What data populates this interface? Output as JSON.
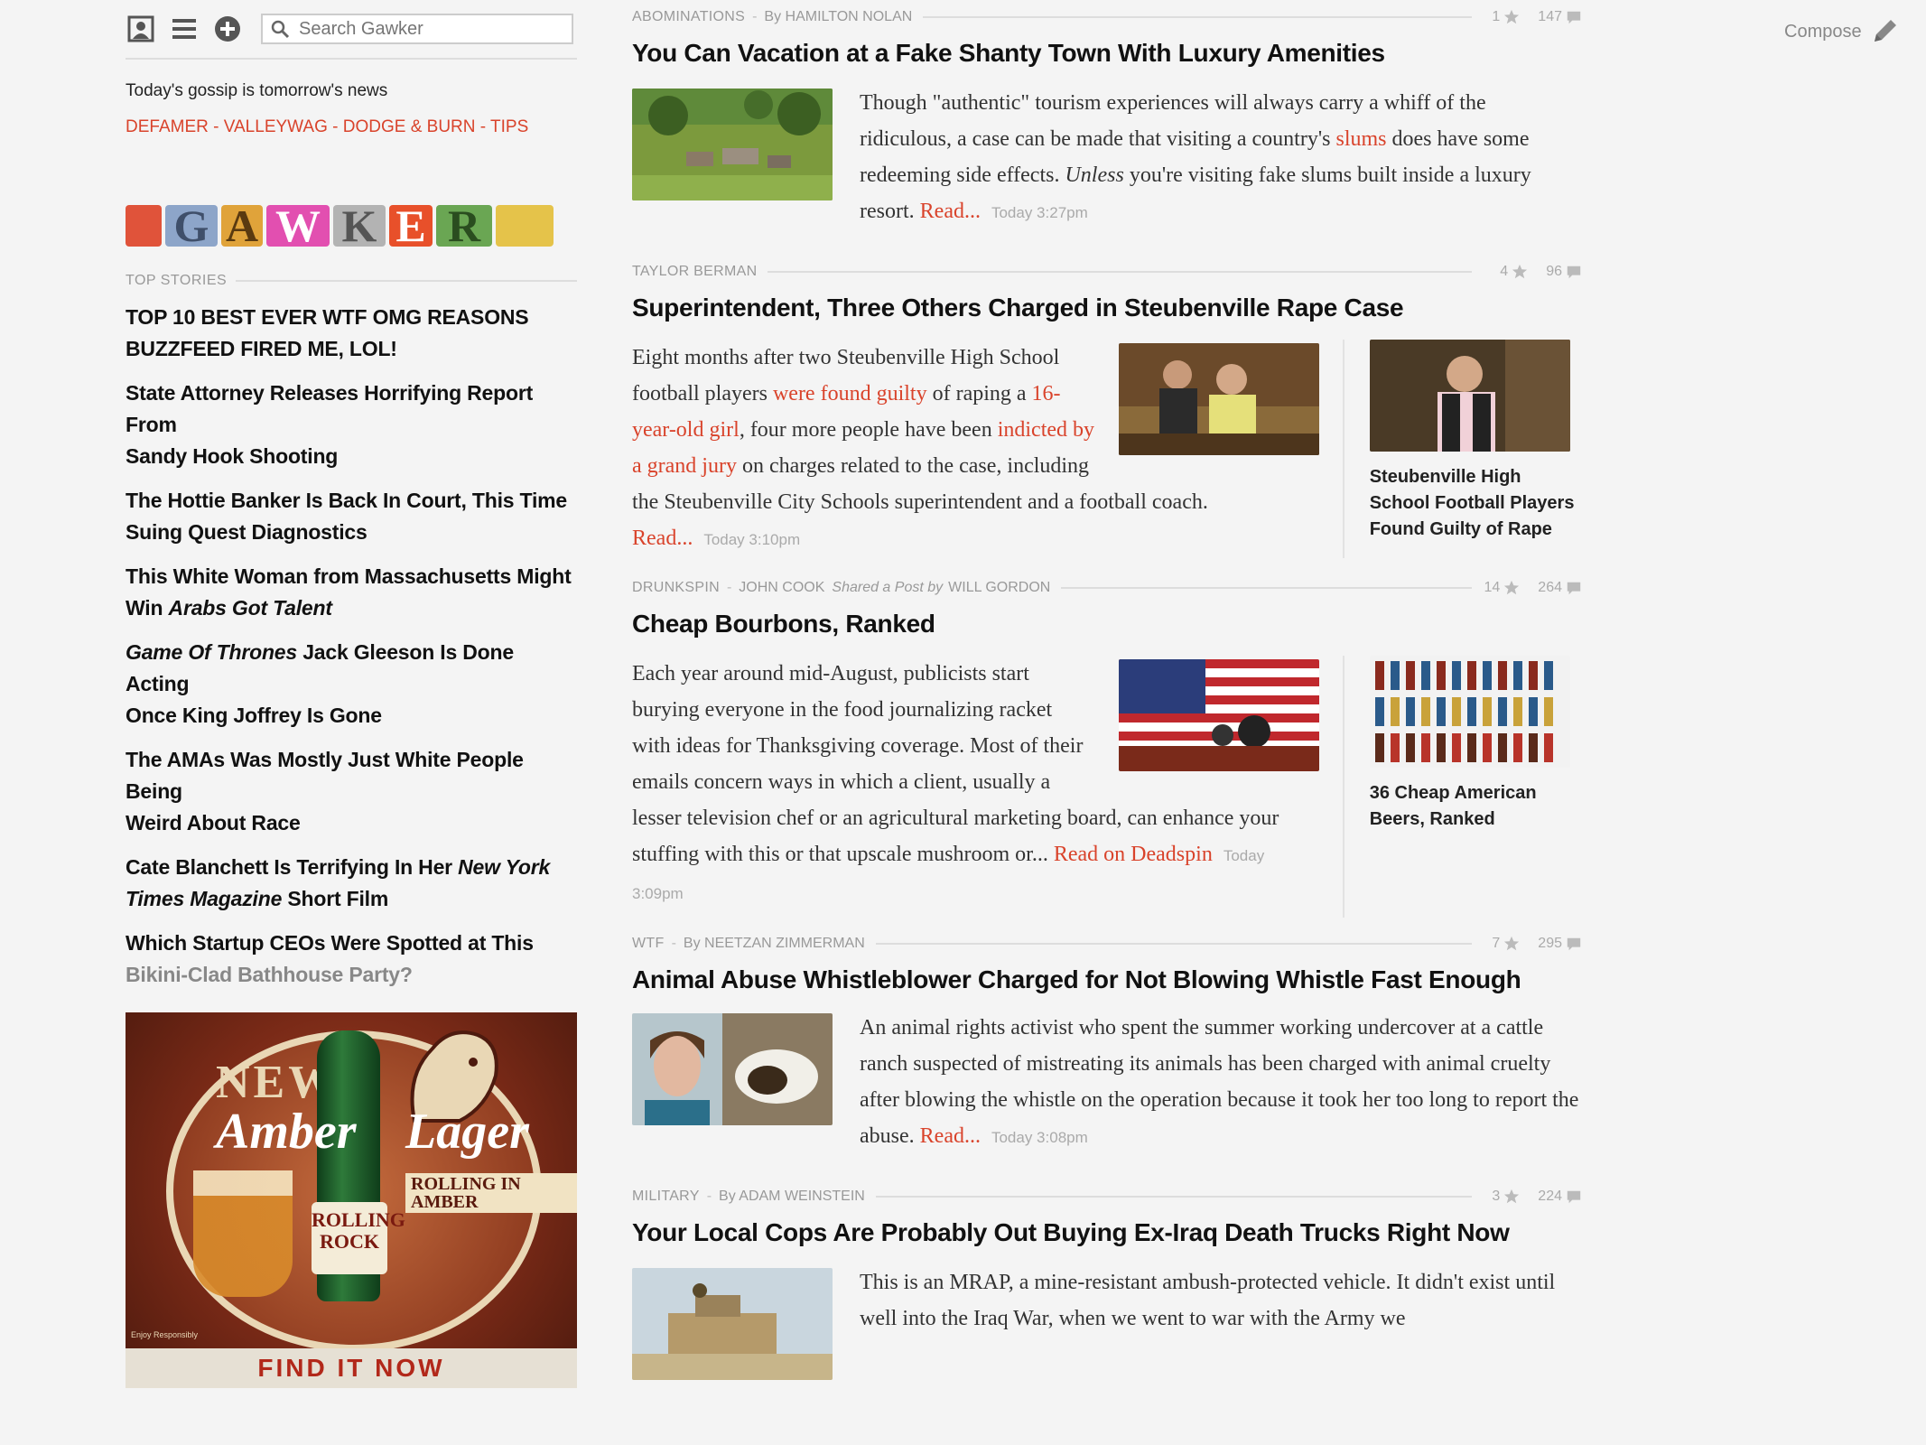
{
  "sidebar": {
    "search_placeholder": "Search Gawker",
    "tagline": "Today's gossip is tomorrow's news",
    "sub_links": [
      "DEFAMER",
      "VALLEYWAG",
      "DODGE & BURN",
      "TIPS"
    ],
    "logo_letters": [
      "G",
      "A",
      "W",
      "K",
      "E",
      "R"
    ],
    "top_stories_label": "TOP STORIES",
    "stories": [
      {
        "line1": "TOP 10 BEST EVER WTF OMG REASONS",
        "line2": "BUZZFEED FIRED ME, LOL!"
      },
      {
        "line1": "State Attorney Releases Horrifying Report From",
        "line2": "Sandy Hook Shooting"
      },
      {
        "line1": "The Hottie Banker Is Back In Court, This Time",
        "line2": "Suing Quest Diagnostics"
      },
      {
        "line1": "This White Woman from Massachusetts Might",
        "line2a": "Win ",
        "line2b": "Arabs Got Talent"
      },
      {
        "line1a": "Game Of Thrones",
        "line1b": " Jack Gleeson Is Done Acting",
        "line2": "Once King Joffrey Is Gone"
      },
      {
        "line1": "The AMAs Was Mostly Just White People Being",
        "line2": "Weird About Race"
      },
      {
        "line1a": "Cate Blanchett Is Terrifying In Her ",
        "line1b": "New York",
        "line2a": "Times Magazine",
        "line2b": " Short Film"
      },
      {
        "line1": "Which Startup CEOs Were Spotted at This",
        "line2": "Bikini-Clad Bathhouse Party?"
      }
    ],
    "ad": {
      "word_new": "NEW",
      "word_amber": "Amber",
      "word_lager": "Lager",
      "bottle_text": "ROLLING ROCK",
      "side_text": "ROLLING IN AMBER",
      "fine_print": "Enjoy Responsibly",
      "cta": "FIND IT NOW"
    }
  },
  "compose_label": "Compose",
  "posts": [
    {
      "category": "ABOMINATIONS",
      "byline": "By HAMILTON NOLAN",
      "stars": "1",
      "comments": "147",
      "title": "You Can Vacation at a Fake Shanty Town With Luxury Amenities",
      "body_a": "Though \"authentic\" tourism experiences will always carry a whiff of the ridiculous, a case can be made that visiting a country's ",
      "body_link": "slums",
      "body_b": " does have some redeeming side effects. ",
      "body_italic": "Unless",
      "body_c": " you're visiting fake slums built inside a luxury resort. ",
      "read": "Read...",
      "time": "Today 3:27pm"
    },
    {
      "category": "TAYLOR BERMAN",
      "stars": "4",
      "comments": "96",
      "title": "Superintendent, Three Others Charged in Steubenville Rape Case",
      "body_a": "Eight months after two Steubenville High School football players ",
      "link1": "were found guilty",
      "body_b": " of raping a ",
      "link2": "16-year-old girl",
      "body_c": ", four more people have been ",
      "link3": "indicted by a grand jury",
      "body_d": " on charges related to the case, including the Steubenville City Schools superintendent and a football coach. ",
      "read": "Read...",
      "time": "Today 3:10pm",
      "related_title": "Steubenville High School Football Players Found Guilty of Rape"
    },
    {
      "category": "DRUNKSPIN",
      "author": "JOHN COOK",
      "shared": "Shared a Post by",
      "sharer": "WILL GORDON",
      "stars": "14",
      "comments": "264",
      "title": "Cheap Bourbons, Ranked",
      "body": "Each year around mid-August, publicists start burying everyone in the food journalizing racket with ideas for Thanksgiving coverage. Most of their emails concern ways in which a client, usually a lesser television chef or an agricultural marketing board, can enhance your stuffing with this or that upscale mushroom or... ",
      "read": "Read on Deadspin",
      "time": "Today 3:09pm",
      "related_title": "36 Cheap American Beers, Ranked"
    },
    {
      "category": "WTF",
      "byline": "By NEETZAN ZIMMERMAN",
      "stars": "7",
      "comments": "295",
      "title": "Animal Abuse Whistleblower Charged for Not Blowing Whistle Fast Enough",
      "body": "An animal rights activist who spent the summer working undercover at a cattle ranch suspected of mistreating its animals has been charged with animal cruelty after blowing the whistle on the operation because it took her too long to report the abuse. ",
      "read": "Read...",
      "time": "Today 3:08pm"
    },
    {
      "category": "MILITARY",
      "byline": "By ADAM WEINSTEIN",
      "stars": "3",
      "comments": "224",
      "title": "Your Local Cops Are Probably Out Buying Ex-Iraq Death Trucks Right Now",
      "body": "This is an MRAP, a mine-resistant ambush-protected vehicle. It didn't exist until well into the Iraq War, when we went to war with the Army we"
    }
  ]
}
